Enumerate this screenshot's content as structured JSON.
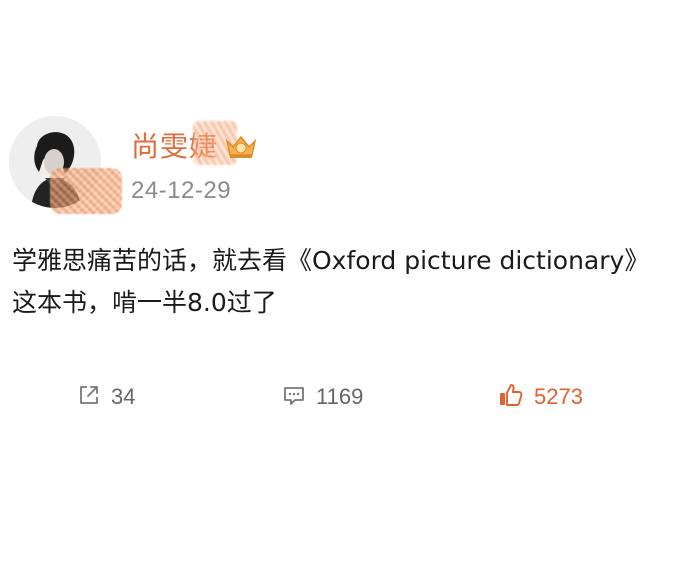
{
  "post": {
    "username": "尚雯婕",
    "date": "24-12-29",
    "content_line1": "学雅思痛苦的话，就去看《Oxford picture dictionary》",
    "content_line2": "这本书，啃一半8.0过了"
  },
  "actions": {
    "repost_count": "34",
    "comment_count": "1169",
    "like_count": "5273"
  },
  "colors": {
    "username": "#e06a3a",
    "like": "#e0622f",
    "muted": "#8a8a8a"
  },
  "icons": {
    "repost": "share-arrow-icon",
    "comment": "comment-bubble-icon",
    "like": "thumbs-up-icon",
    "badge": "crown-badge-icon"
  }
}
